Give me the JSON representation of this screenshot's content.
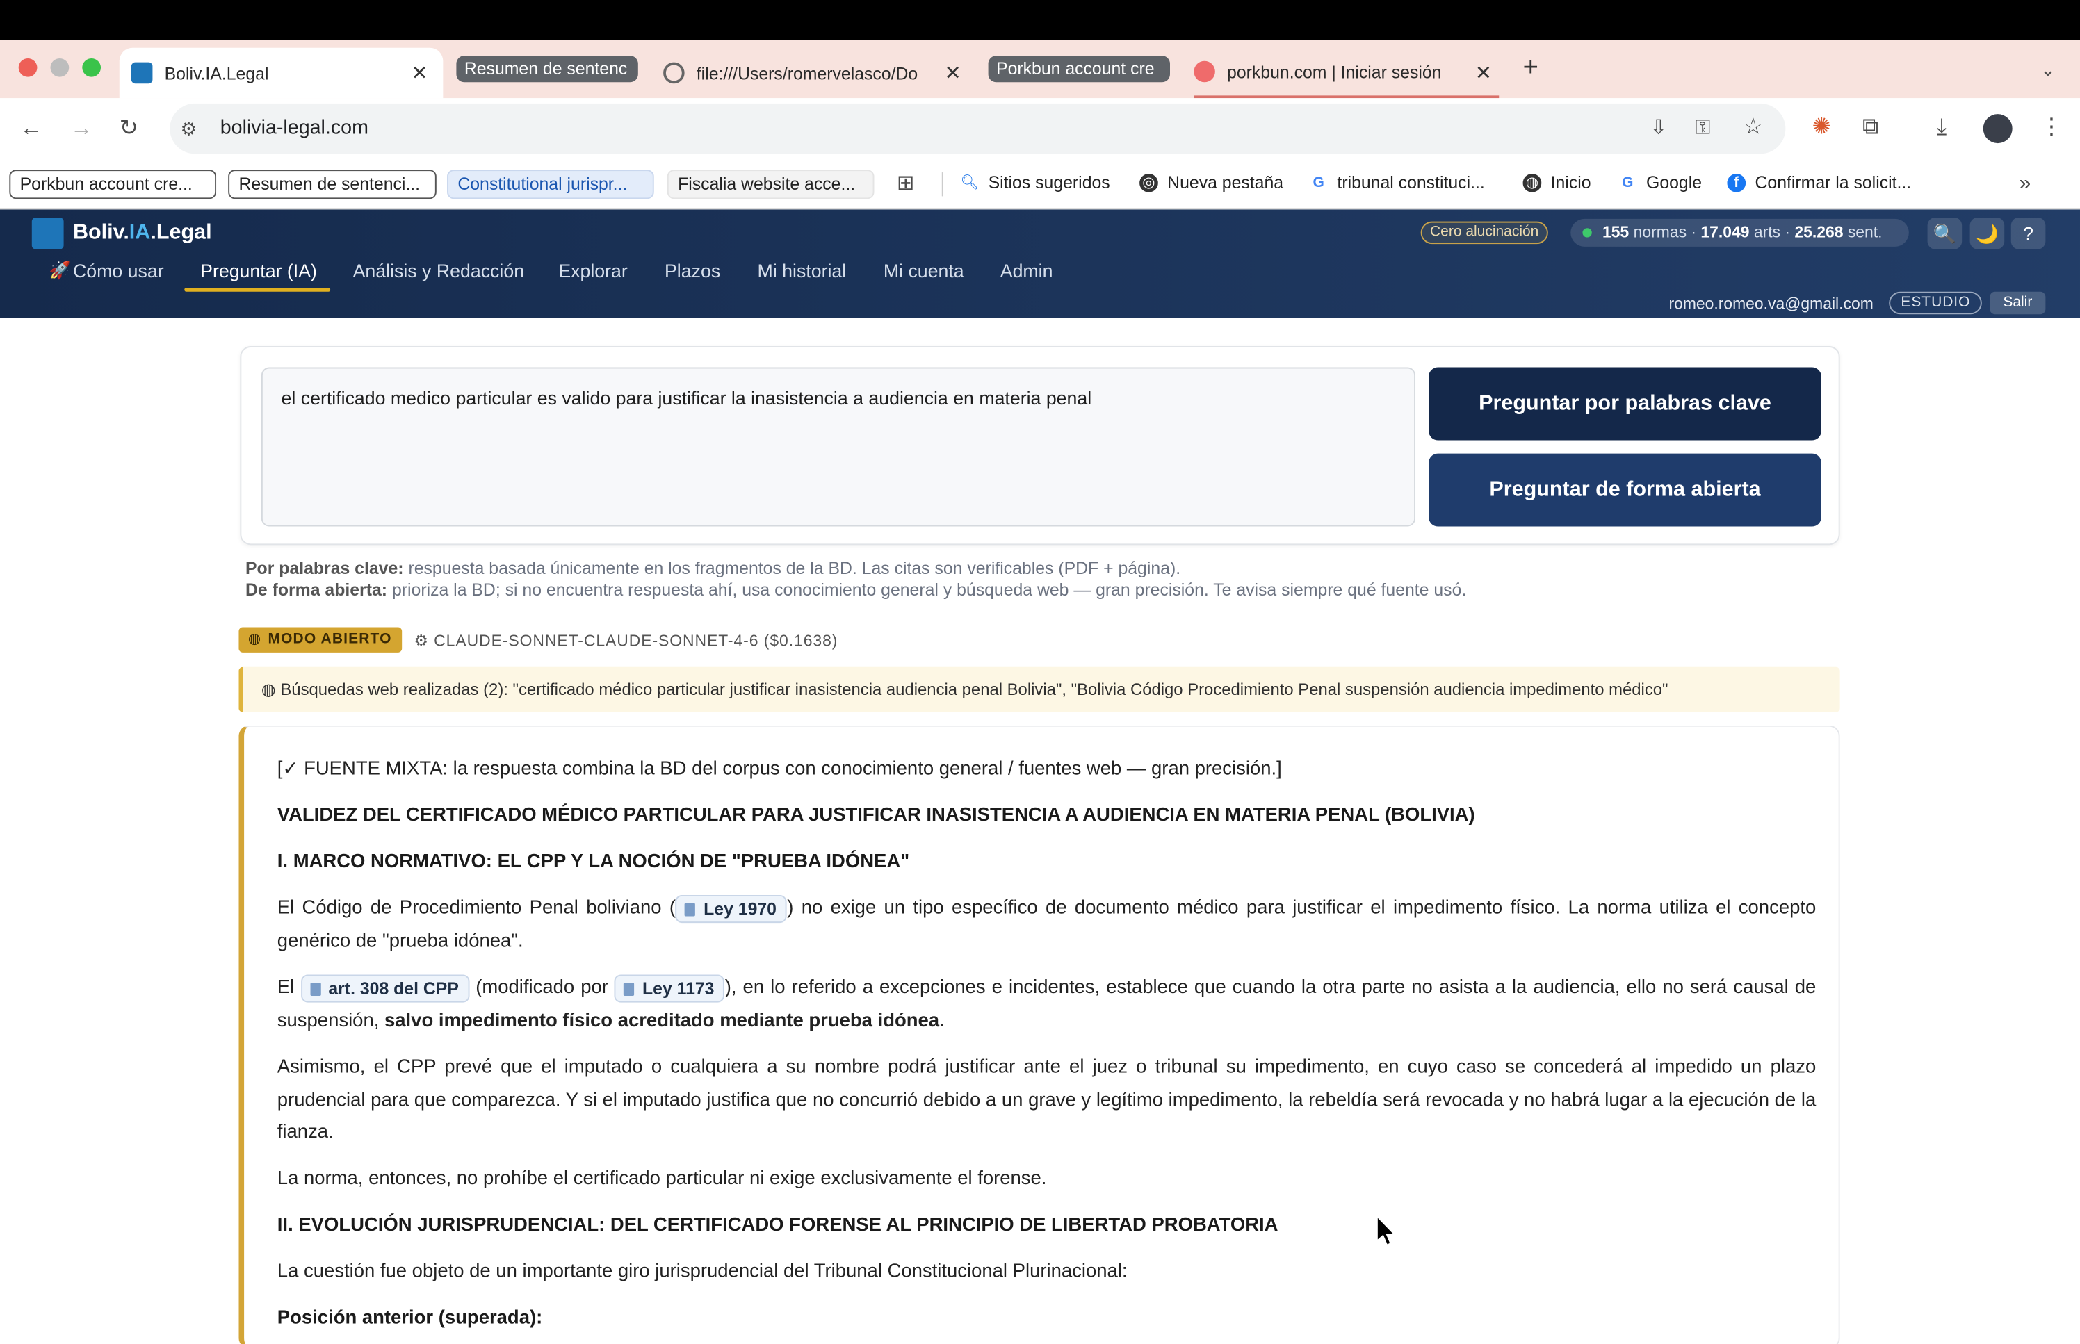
{
  "browser": {
    "tabs": [
      {
        "title": "Boliv.IA.Legal"
      },
      {
        "title": "Resumen de sentenc"
      },
      {
        "title": "file:///Users/romervelasco/Do"
      },
      {
        "title": "Porkbun account cre"
      },
      {
        "title": "porkbun.com | Iniciar sesión"
      }
    ],
    "new_tab": "+",
    "url": "bolivia-legal.com",
    "bookmarks_chips": [
      "Porkbun account cre...",
      "Resumen de sentenci...",
      "Constitutional jurispr...",
      "Fiscalia website acce..."
    ],
    "bookmarks": [
      "Sitios sugeridos",
      "Nueva pestaña",
      "tribunal constituci...",
      "Inicio",
      "Google",
      "Confirmar la solicit..."
    ],
    "more": "»"
  },
  "app": {
    "logo": {
      "pre": "Boliv.",
      "mid": "IA",
      "post": ".Legal"
    },
    "nav": [
      "Cómo usar",
      "Preguntar (IA)",
      "Análisis y Redacción",
      "Explorar",
      "Plazos",
      "Mi historial",
      "Mi cuenta",
      "Admin"
    ],
    "nav_rocket": "🚀",
    "cero_badge": "Cero alucinación",
    "stats": {
      "normas": "155",
      "normas_label": "normas",
      "arts": "17.049",
      "arts_label": "arts",
      "sent": "25.268",
      "sent_label": "sent.",
      "sep": "·"
    },
    "header_buttons": [
      "🔍",
      "🌙",
      "?"
    ],
    "user_email": "romeo.romeo.va@gmail.com",
    "plan": "ESTUDIO",
    "logout": "Salir"
  },
  "query": {
    "text": "el certificado medico particular es valido para justificar la inasistencia a audiencia en materia penal",
    "btn_keywords": "Preguntar por palabras clave",
    "btn_open": "Preguntar de forma abierta",
    "help_kw_label": "Por palabras clave:",
    "help_kw_text": "respuesta basada únicamente en los fragmentos de la BD. Las citas son verificables (PDF + página).",
    "help_open_label": "De forma abierta:",
    "help_open_text": "prioriza la BD; si no encuentra respuesta ahí, usa conocimiento general y búsqueda web — gran precisión. Te avisa siempre qué fuente usó."
  },
  "result": {
    "mode_badge": "MODO ABIERTO",
    "model": "CLAUDE-SONNET-CLAUDE-SONNET-4-6 ($0.1638)",
    "web_searches": "Búsquedas web realizadas (2): \"certificado médico particular justificar inasistencia audiencia penal Bolivia\", \"Bolivia Código Procedimiento Penal suspensión audiencia impedimento médico\"",
    "source_note": "[✓ FUENTE MIXTA: la respuesta combina la BD del corpus con conocimiento general / fuentes web — gran precisión.]",
    "title": "VALIDEZ DEL CERTIFICADO MÉDICO PARTICULAR PARA JUSTIFICAR INASISTENCIA A AUDIENCIA EN MATERIA PENAL (BOLIVIA)",
    "h1": "I. MARCO NORMATIVO: EL CPP Y LA NOCIÓN DE \"PRUEBA IDÓNEA\"",
    "p1a": "El Código de Procedimiento Penal boliviano (",
    "cite_ley1970": "Ley 1970",
    "p1b": ") no exige un tipo específico de documento médico para justificar el impedimento físico. La norma utiliza el concepto genérico de \"prueba idónea\".",
    "p2a": "El",
    "cite_art308": "art. 308 del CPP",
    "p2b": "(modificado por",
    "cite_ley1173": "Ley 1173",
    "p2c": "), en lo referido a excepciones e incidentes, establece que cuando la otra parte no asista a la audiencia, ello no será causal de suspensión,",
    "p2bold": "salvo impedimento físico acreditado mediante prueba idónea",
    "p2end": ".",
    "p3": "Asimismo, el CPP prevé que el imputado o cualquiera a su nombre podrá justificar ante el juez o tribunal su impedimento, en cuyo caso se concederá al impedido un plazo prudencial para que comparezca. Y si el imputado justifica que no concurrió debido a un grave y legítimo impedimento, la rebeldía será revocada y no habrá lugar a la ejecución de la fianza.",
    "p4": "La norma, entonces, no prohíbe el certificado particular ni exige exclusivamente el forense.",
    "h2": "II. EVOLUCIÓN JURISPRUDENCIAL: DEL CERTIFICADO FORENSE AL PRINCIPIO DE LIBERTAD PROBATORIA",
    "p5": "La cuestión fue objeto de un importante giro jurisprudencial del Tribunal Constitucional Plurinacional:",
    "h3": "Posición anterior (superada):"
  },
  "colors": {
    "header_dark": "#152a4c",
    "accent_gold": "#d4a530",
    "btn_dark": "#14284a",
    "btn_blue": "#1f3c6c"
  }
}
